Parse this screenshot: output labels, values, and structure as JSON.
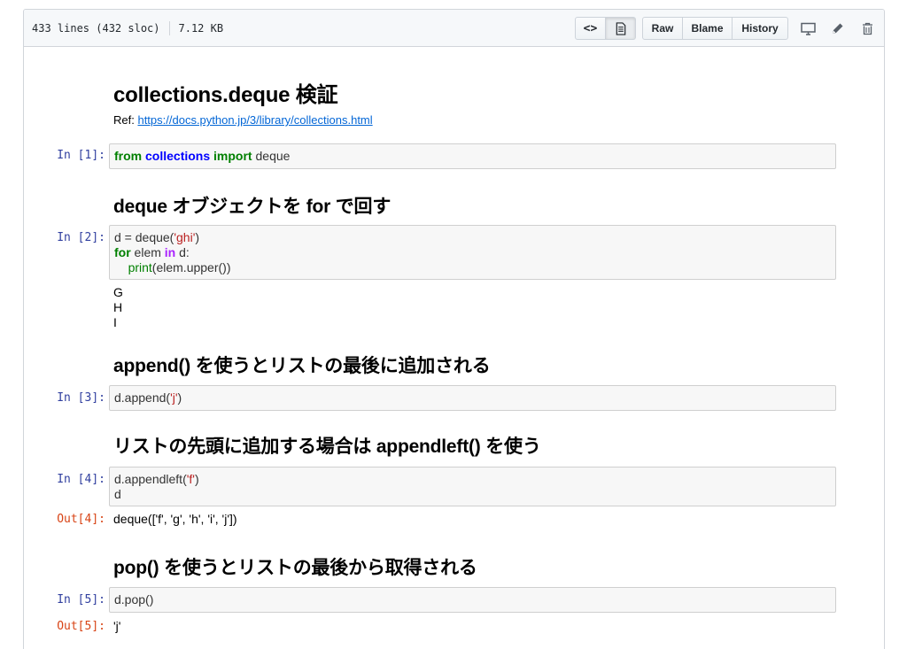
{
  "header": {
    "lines_info": "433 lines (432 sloc)",
    "size_info": "7.12 KB",
    "buttons": {
      "raw": "Raw",
      "blame": "Blame",
      "history": "History"
    },
    "code_view_glyph": "<>"
  },
  "notebook": {
    "title": "collections.deque 検証",
    "ref_label": "Ref:",
    "ref_link": "https://docs.python.jp/3/library/collections.html",
    "heading2": "deque オブジェクトを for で回す",
    "heading3": "append() を使うとリストの最後に追加される",
    "heading4": "リストの先頭に追加する場合は appendleft() を使う",
    "heading5": "pop() を使うとリストの最後から取得される",
    "cells": [
      {
        "prompt": "In [1]:",
        "tokens": [
          "from",
          " ",
          "collections",
          " ",
          "import",
          " deque"
        ]
      },
      {
        "prompt": "In [2]:",
        "line1": [
          "d = deque(",
          "'ghi'",
          ")"
        ],
        "line2": [
          "for",
          " elem ",
          "in",
          " d:"
        ],
        "line3": [
          "    ",
          "print",
          "(elem.upper())"
        ],
        "output": "G\nH\nI"
      },
      {
        "prompt": "In [3]:",
        "tokens": [
          "d.append(",
          "'j'",
          ")"
        ]
      },
      {
        "prompt": "In [4]:",
        "line1": [
          "d.appendleft(",
          "'f'",
          ")"
        ],
        "line2": "d",
        "out_prompt": "Out[4]:",
        "output": "deque(['f', 'g', 'h', 'i', 'j'])"
      },
      {
        "prompt": "In [5]:",
        "tokens": "d.pop()",
        "out_prompt": "Out[5]:",
        "output": "'j'"
      }
    ]
  },
  "colors": {
    "in_prompt": "#303f9f",
    "out_prompt": "#d84315",
    "link": "#0366d6",
    "keyword": "#008000",
    "module": "#0000ff",
    "string": "#ba2121",
    "operator_in": "#aa22ff"
  },
  "icons": [
    "code-icon",
    "file-text-icon",
    "desktop-icon",
    "pencil-icon",
    "trash-icon"
  ]
}
